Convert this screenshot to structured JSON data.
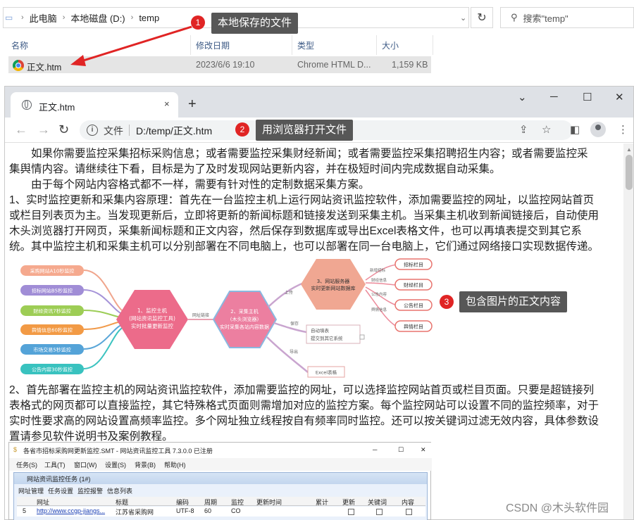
{
  "explorer": {
    "breadcrumb": [
      "此电脑",
      "本地磁盘 (D:)",
      "temp"
    ],
    "search_placeholder": "搜索\"temp\"",
    "columns": {
      "name": "名称",
      "modified": "修改日期",
      "type": "类型",
      "size": "大小"
    },
    "file": {
      "name": "正文.htm",
      "modified": "2023/6/6 19:10",
      "type": "Chrome HTML D...",
      "size": "1,159 KB"
    }
  },
  "annotations": [
    {
      "num": "1",
      "text": "本地保存的文件"
    },
    {
      "num": "2",
      "text": "用浏览器打开文件"
    },
    {
      "num": "3",
      "text": "包含图片的正文内容"
    }
  ],
  "browser": {
    "tab_title": "正文.htm",
    "tab_close": "×",
    "new_tab": "+",
    "omnibox": {
      "scheme_label": "文件",
      "url": "D:/temp/正文.htm"
    },
    "content": {
      "para1_line1": "　　如果你需要监控采集招标采购信息；或者需要监控采集财经新闻；或者需要监控采集招聘招生内容；或者需要监控采",
      "para1_line2": "集舆情内容。请继续往下看，目标是为了及时发现网站更新内容，并在极短时间内完成数据自动采集。",
      "para2": "　　由于每个网站内容格式都不一样，需要有针对性的定制数据采集方案。",
      "para3_line1": "1、实时监控更新和采集内容原理：首先在一台监控主机上运行网站资讯监控软件，添加需要监控的网址，以监控网站首页",
      "para3_line2": "或栏目列表页为主。当发现更新后，立即将更新的新闻标题和链接发送到采集主机。当采集主机收到新闻链接后，自动使用",
      "para3_line3": "木头浏览器打开网页，采集新闻标题和正文内容，然后保存到数据库或导出Excel表格文件，也可以再填表提交到其它系",
      "para3_line4": "统。其中监控主机和采集主机可以分别部署在不同电脑上，也可以部署在同一台电脑上，它们通过网络接口实现数据传递。",
      "para4_line1": "2、首先部署在监控主机的网站资讯监控软件，添加需要监控的网址，可以选择监控网站首页或栏目页面。只要是超链接列",
      "para4_line2": "表格式的网页都可以直接监控，其它特殊格式页面则需增加对应的监控方案。每个监控网站可以设置不同的监控频率，对于",
      "para4_line3": "实时性要求高的网站设置高频率监控。多个网址独立线程按自有频率同时监控。还可以按关键词过滤无效内容，具体参数设",
      "para4_line4": "置请参见软件说明书及案例教程。"
    },
    "diagram": {
      "sources": [
        "采购网站A10秒监控",
        "招标网站B5秒监控",
        "财经资讯7秒监控",
        "舆情信息60秒监控",
        "市场交易5秒监控",
        "公告内容30秒监控"
      ],
      "hex1": [
        "1、监控主机",
        "(网站资讯监控工具)",
        "实时批量更新监控"
      ],
      "edge1": "网址链接",
      "hex2": [
        "2、采集主机",
        "(木头浏览器)",
        "实时采集各站内容数据"
      ],
      "hex3": [
        "3、网站服务器",
        "实时更新网站数据库"
      ],
      "edge_up": "上传",
      "edge_save": "保存",
      "edge_export": "导出",
      "columns": [
        "招标栏目",
        "财经栏目",
        "公告栏目",
        "舆情栏目"
      ],
      "col_edges": [
        "新增招标",
        "财经信息",
        "公告内容",
        "舆情信息"
      ],
      "autofill": [
        "自动填表",
        "提交到其它系统"
      ],
      "excel": "Excel表格"
    },
    "app_screenshot": {
      "title": "各省市招标采购网更新监控.SMT - 网站资讯监控工具 7.3.0.0 已注册",
      "menu": [
        "任务(S)",
        "工具(T)",
        "窗口(W)",
        "设置(S)",
        "背景(B)",
        "帮助(H)"
      ],
      "panel_title": "网站资讯监控任务 (1#)",
      "tabs": [
        "网址管理",
        "任务设置",
        "监控报警",
        "信息列表"
      ],
      "headers": [
        "网址",
        "标题",
        "编码",
        "周期",
        "监控",
        "更新时间",
        "累计",
        "更新",
        "关键词",
        "内容"
      ],
      "row": {
        "num": "5",
        "url": "http://www.ccgp-jiangs...",
        "title": "江苏省采购网",
        "encoding": "UTF-8",
        "period": "60",
        "monitor": "CO"
      }
    }
  },
  "watermark": "CSDN @木头软件园"
}
